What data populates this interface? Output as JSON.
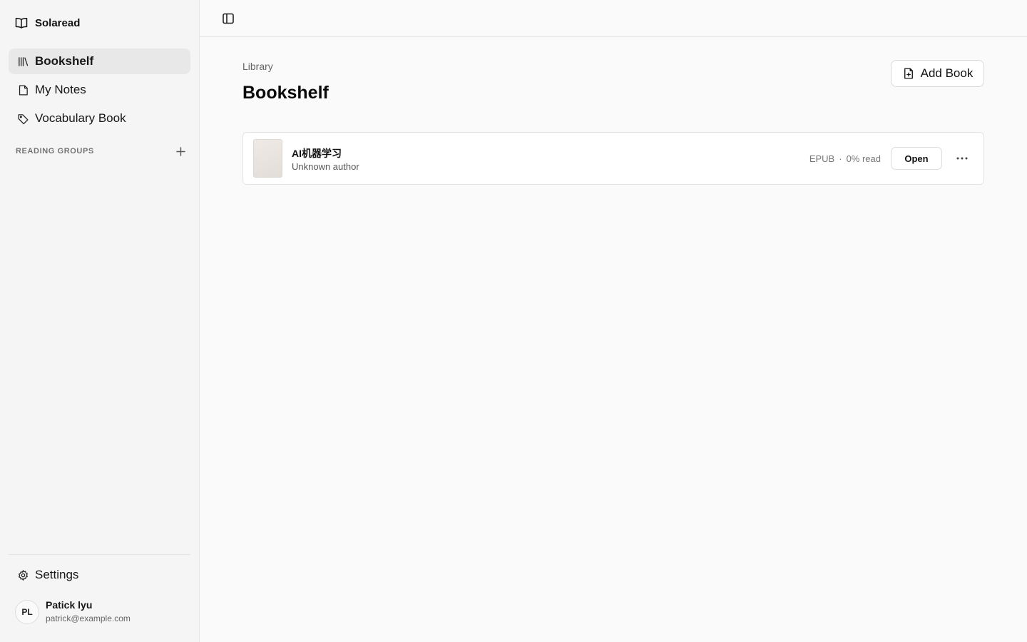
{
  "app": {
    "name": "Solaread"
  },
  "sidebar": {
    "nav": [
      {
        "label": "Bookshelf",
        "icon": "library-icon",
        "active": true
      },
      {
        "label": "My Notes",
        "icon": "notes-icon",
        "active": false
      },
      {
        "label": "Vocabulary Book",
        "icon": "tag-icon",
        "active": false
      }
    ],
    "groups_title": "READING GROUPS",
    "groups_add": "+",
    "settings_label": "Settings",
    "user": {
      "initials": "PL",
      "name": "Patick lyu",
      "email": "patrick@example.com"
    }
  },
  "main": {
    "breadcrumb": "Library",
    "title": "Bookshelf",
    "add_book_label": "Add Book",
    "books": [
      {
        "title": "AI机器学习",
        "author": "Unknown author",
        "format": "EPUB",
        "separator": "·",
        "progress": "0% read",
        "open_label": "Open",
        "more_label": "···"
      }
    ]
  },
  "colors": {
    "sidebar_bg": "#f5f5f5",
    "active_item_bg": "#e8e8e8",
    "page_bg": "#fafafa",
    "border": "#e5e5e5"
  }
}
